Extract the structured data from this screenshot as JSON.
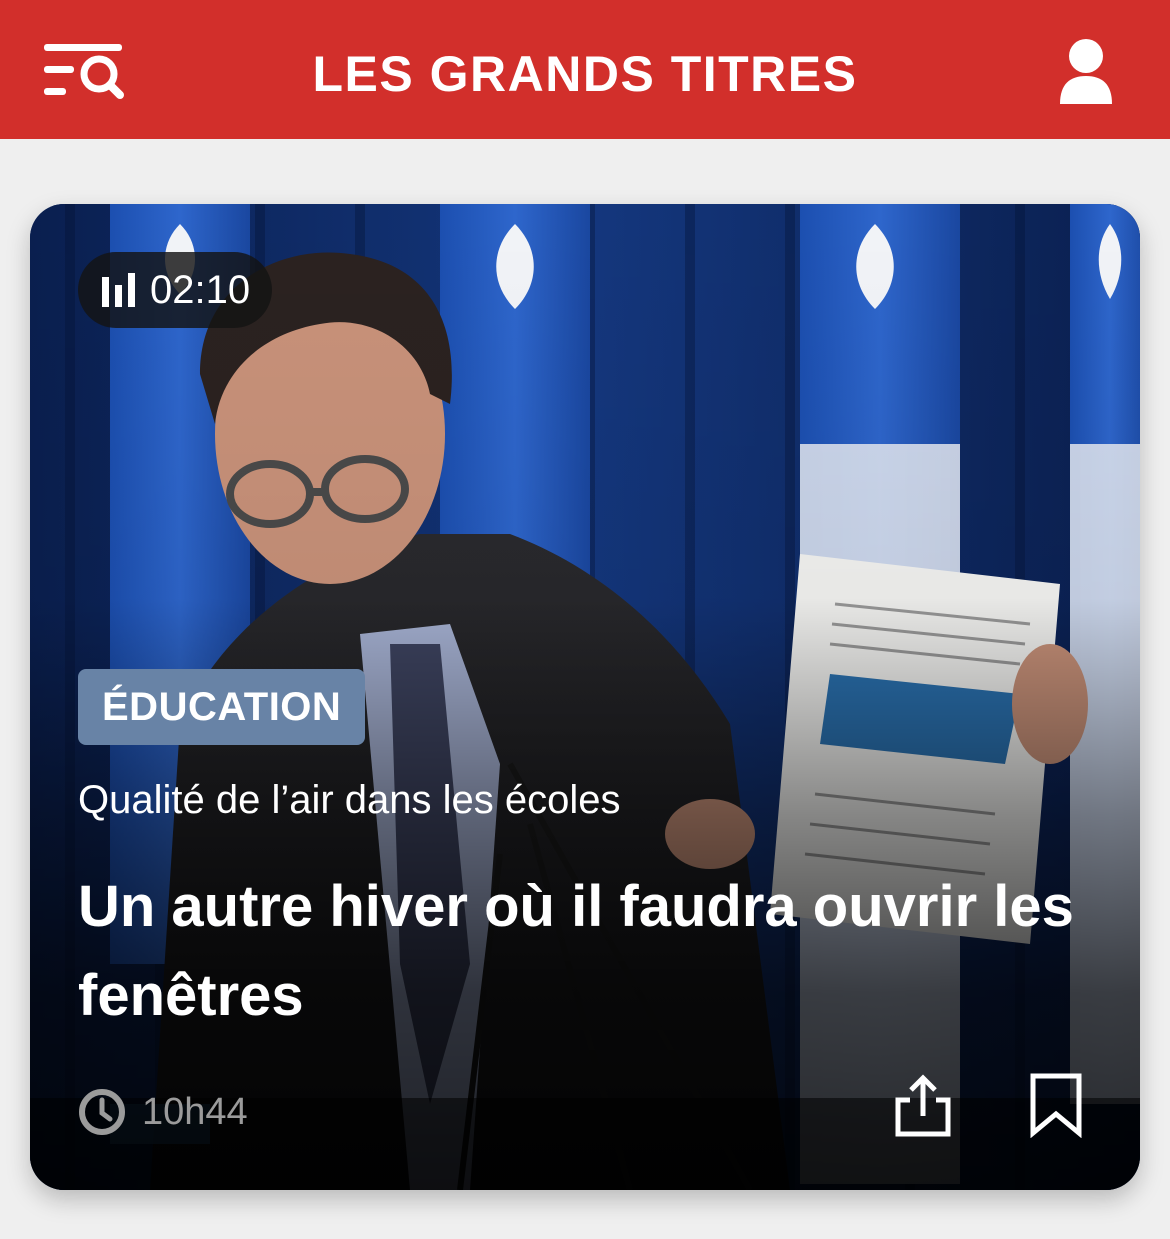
{
  "header": {
    "title": "LES GRANDS TITRES",
    "menu_icon": "menu-search-icon",
    "profile_icon": "user-icon",
    "background_color": "#d22f2b"
  },
  "card": {
    "duration": "02:10",
    "duration_icon": "audio-bars-icon",
    "category": "ÉDUCATION",
    "category_color": "#6883a6",
    "kicker": "Qualité de l’air dans les écoles",
    "headline": "Un autre hiver où il faudra ouvrir les fenêtres",
    "time": "10h44",
    "time_icon": "clock-icon",
    "actions": {
      "share_icon": "share-icon",
      "bookmark_icon": "bookmark-icon"
    }
  }
}
